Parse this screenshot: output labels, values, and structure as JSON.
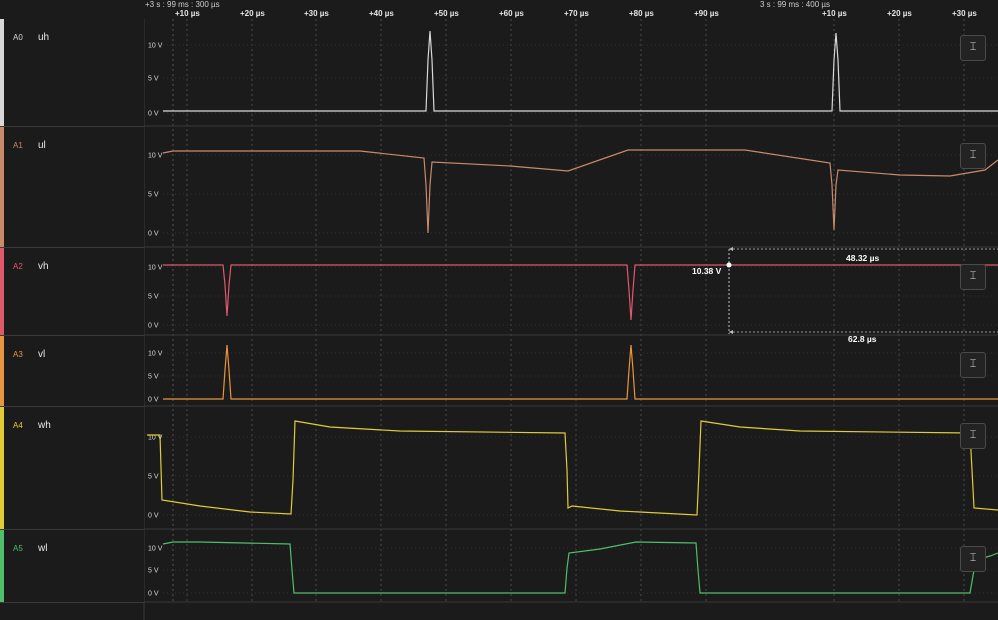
{
  "timebar": {
    "ref_left": "+3 s : 99 ms : 300 µs",
    "ref_right": "3 s : 99 ms : 400 µs",
    "ticks_first": [
      "+10 µs",
      "+20 µs",
      "+30 µs",
      "+40 µs",
      "+50 µs",
      "+60 µs",
      "+70 µs",
      "+80 µs",
      "+90 µs"
    ],
    "ticks_second": [
      "+10 µs",
      "+20 µs",
      "+30 µs"
    ]
  },
  "channels": [
    {
      "id": "A0",
      "name": "uh",
      "color": "#d8d8d8"
    },
    {
      "id": "A1",
      "name": "ul",
      "color": "#c98a6a"
    },
    {
      "id": "A2",
      "name": "vh",
      "color": "#e0596a"
    },
    {
      "id": "A3",
      "name": "vl",
      "color": "#e8953f"
    },
    {
      "id": "A4",
      "name": "wh",
      "color": "#e2cc36"
    },
    {
      "id": "A5",
      "name": "wl",
      "color": "#4fbf6a"
    }
  ],
  "volt_labels": {
    "ten": "10 V",
    "five": "5 V",
    "zero": "0 V"
  },
  "scale_button_icon": "fit-vertical-icon",
  "scale_button_glyph": "⌶",
  "measurement": {
    "value": "10.38 V",
    "width": "48.32 µs",
    "period": "62.8 µs"
  }
}
